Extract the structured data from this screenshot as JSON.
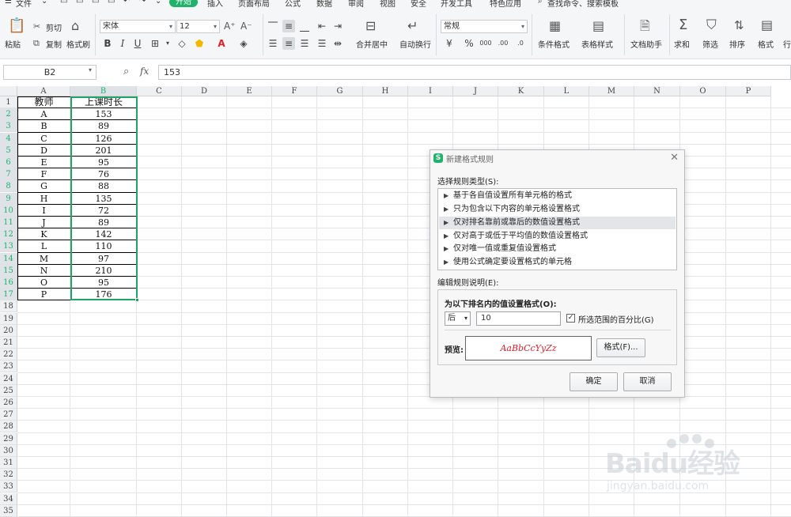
{
  "menu": {
    "file": "文件",
    "tabs": [
      "开始",
      "插入",
      "页面布局",
      "公式",
      "数据",
      "审阅",
      "视图",
      "安全",
      "开发工具",
      "特色应用"
    ],
    "active_tab": "开始",
    "search": "查找命令、搜索模板"
  },
  "ribbon": {
    "paste": "粘贴",
    "cut": "剪切",
    "copy": "复制",
    "format_painter": "格式刷",
    "font_name": "宋体",
    "font_size": "12",
    "merge_center": "合并居中",
    "wrap_text": "自动换行",
    "number_format": "常规",
    "conditional_format": "条件格式",
    "table_style": "表格样式",
    "doc_assistant": "文档助手",
    "sum": "求和",
    "filter": "筛选",
    "sort": "排序",
    "format": "格式",
    "rows_cols": "行"
  },
  "formula_bar": {
    "name_box": "B2",
    "fx": "fx",
    "value": "153"
  },
  "sheet": {
    "columns": [
      "A",
      "B",
      "C",
      "D",
      "E",
      "F",
      "G",
      "H",
      "I",
      "J",
      "K",
      "L",
      "M",
      "N",
      "O",
      "P"
    ],
    "rows": [
      "1",
      "2",
      "3",
      "4",
      "5",
      "6",
      "7",
      "8",
      "9",
      "10",
      "11",
      "12",
      "13",
      "14",
      "15",
      "16",
      "17",
      "18",
      "19",
      "20",
      "21",
      "22",
      "23",
      "24",
      "25",
      "26",
      "27",
      "28",
      "29",
      "30",
      "31",
      "32",
      "33",
      "34",
      "35"
    ],
    "header": [
      "教师",
      "上课时长"
    ],
    "data": [
      [
        "A",
        "153"
      ],
      [
        "B",
        "89"
      ],
      [
        "C",
        "126"
      ],
      [
        "D",
        "201"
      ],
      [
        "E",
        "95"
      ],
      [
        "F",
        "76"
      ],
      [
        "G",
        "88"
      ],
      [
        "H",
        "135"
      ],
      [
        "I",
        "72"
      ],
      [
        "J",
        "89"
      ],
      [
        "K",
        "142"
      ],
      [
        "L",
        "110"
      ],
      [
        "M",
        "97"
      ],
      [
        "N",
        "210"
      ],
      [
        "O",
        "95"
      ],
      [
        "P",
        "176"
      ]
    ]
  },
  "dialog": {
    "title": "新建格式规则",
    "select_type_label": "选择规则类型(S):",
    "rule_types": [
      "基于各自值设置所有单元格的格式",
      "只为包含以下内容的单元格设置格式",
      "仅对排名靠前或靠后的数值设置格式",
      "仅对高于或低于平均值的数值设置格式",
      "仅对唯一值或重复值设置格式",
      "使用公式确定要设置格式的单元格"
    ],
    "selected_rule_index": 2,
    "edit_desc_label": "编辑规则说明(E):",
    "desc_heading": "为以下排名内的值设置格式(O):",
    "rank_position": "后",
    "rank_value": "10",
    "percent_checkbox_label": "所选范围的百分比(G)",
    "percent_checked": true,
    "preview_label": "预览:",
    "preview_text": "AaBbCcYyZz",
    "preview_color": "#e0202a",
    "format_button": "格式(F)...",
    "ok_button": "确定",
    "cancel_button": "取消"
  },
  "watermark": {
    "brand": "Baidu经验",
    "url": "jingyan.baidu.com"
  },
  "colors": {
    "accent": "#20b26b",
    "selection": "#21a366"
  }
}
